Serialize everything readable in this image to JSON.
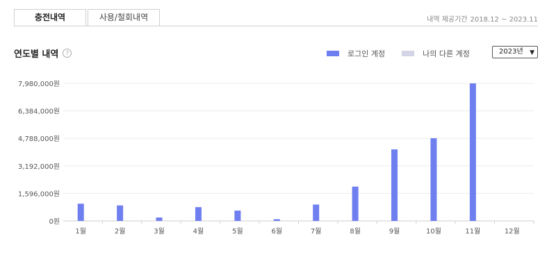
{
  "tabs": [
    {
      "label": "충전내역",
      "active": true
    },
    {
      "label": "사용/철회내역",
      "active": false
    }
  ],
  "period": {
    "prefix": "내역 제공기간",
    "range": "2018.12 ~ 2023.11"
  },
  "section": {
    "title": "연도별 내역",
    "help_icon": "question-circle-icon",
    "help_symbol": "?"
  },
  "legend": [
    {
      "label": "로그인 계정",
      "color": "#6f7ff0"
    },
    {
      "label": "나의 다른 계정",
      "color": "#d3d5e6"
    }
  ],
  "year_select": {
    "value": "2023년",
    "icon": "chevron-down-icon"
  },
  "chart_data": {
    "type": "bar",
    "categories": [
      "1월",
      "2월",
      "3월",
      "4월",
      "5월",
      "6월",
      "7월",
      "8월",
      "9월",
      "10월",
      "11월",
      "12월"
    ],
    "series": [
      {
        "name": "로그인 계정",
        "color": "#6f7ff0",
        "values": [
          1000000,
          900000,
          200000,
          800000,
          600000,
          100000,
          950000,
          1990000,
          4150000,
          4800000,
          7980000,
          0
        ]
      }
    ],
    "y_ticks": [
      {
        "value": 7980000,
        "label": "7,980,000원"
      },
      {
        "value": 6384000,
        "label": "6,384,000원"
      },
      {
        "value": 4788000,
        "label": "4,788,000원"
      },
      {
        "value": 3192000,
        "label": "3,192,000원"
      },
      {
        "value": 1596000,
        "label": "1,596,000원"
      },
      {
        "value": 0,
        "label": "0원"
      }
    ],
    "ylim": [
      0,
      7980000
    ],
    "grid": true,
    "title": "",
    "xlabel": "",
    "ylabel": ""
  }
}
